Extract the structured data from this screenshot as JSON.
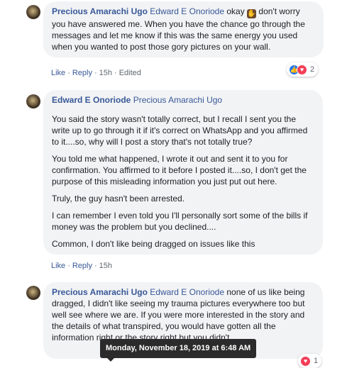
{
  "comments": [
    {
      "author": "Precious Amarachi Ugo",
      "mention": "Edward E Onoriode",
      "text_before_emoji": "okay",
      "emoji": "👌🏿",
      "text_after_emoji": "don't worry you have answered me. When you have the chance go through the messages and let me know if this was the same energy you used when you wanted to post those gory pictures on your wall.",
      "actions": {
        "like": "Like",
        "reply": "Reply",
        "time": "15h",
        "edited": "Edited"
      },
      "reactions": {
        "types": [
          "like",
          "love"
        ],
        "count": "2"
      }
    },
    {
      "author": "Edward E Onoriode",
      "mention": "Precious Amarachi Ugo",
      "paragraphs": [
        "You said the story wasn't totally correct, but I recall I sent you the write up to go through it if it's correct on WhatsApp and you affirmed to it....so, why will I post a story that's not totally true?",
        "You told me what happened, I wrote it out and sent it to you for confirmation. You affirmed to it before I posted it....so, I don't get the purpose of this misleading information you just put out here.",
        "Truly, the guy hasn't been arrested.",
        "I can remember I even told you I'll personally sort some of the bills if money was the problem but you declined....",
        "Common, I don't like being dragged on issues like this"
      ],
      "actions": {
        "like": "Like",
        "reply": "Reply",
        "time": "15h"
      }
    },
    {
      "author": "Precious Amarachi Ugo",
      "mention": "Edward E Onoriode",
      "text": "none of us like being dragged, I didn't like seeing my trauma pictures everywhere too but well see where we are. If you were more interested in the story and the details of what transpired, you would have gotten all the information right or the story right but you didn't.",
      "reactions": {
        "types": [
          "love"
        ],
        "count": "1"
      }
    }
  ],
  "tooltip": {
    "text": "Monday, November 18, 2019 at 6:48 AM"
  },
  "colors": {
    "link": "#385898",
    "bubble": "#f2f3f5",
    "meta": "#606770",
    "tooltip_bg": "#2b2b2b"
  },
  "icons": {
    "like": "thumbs-up-icon",
    "love": "heart-icon"
  }
}
